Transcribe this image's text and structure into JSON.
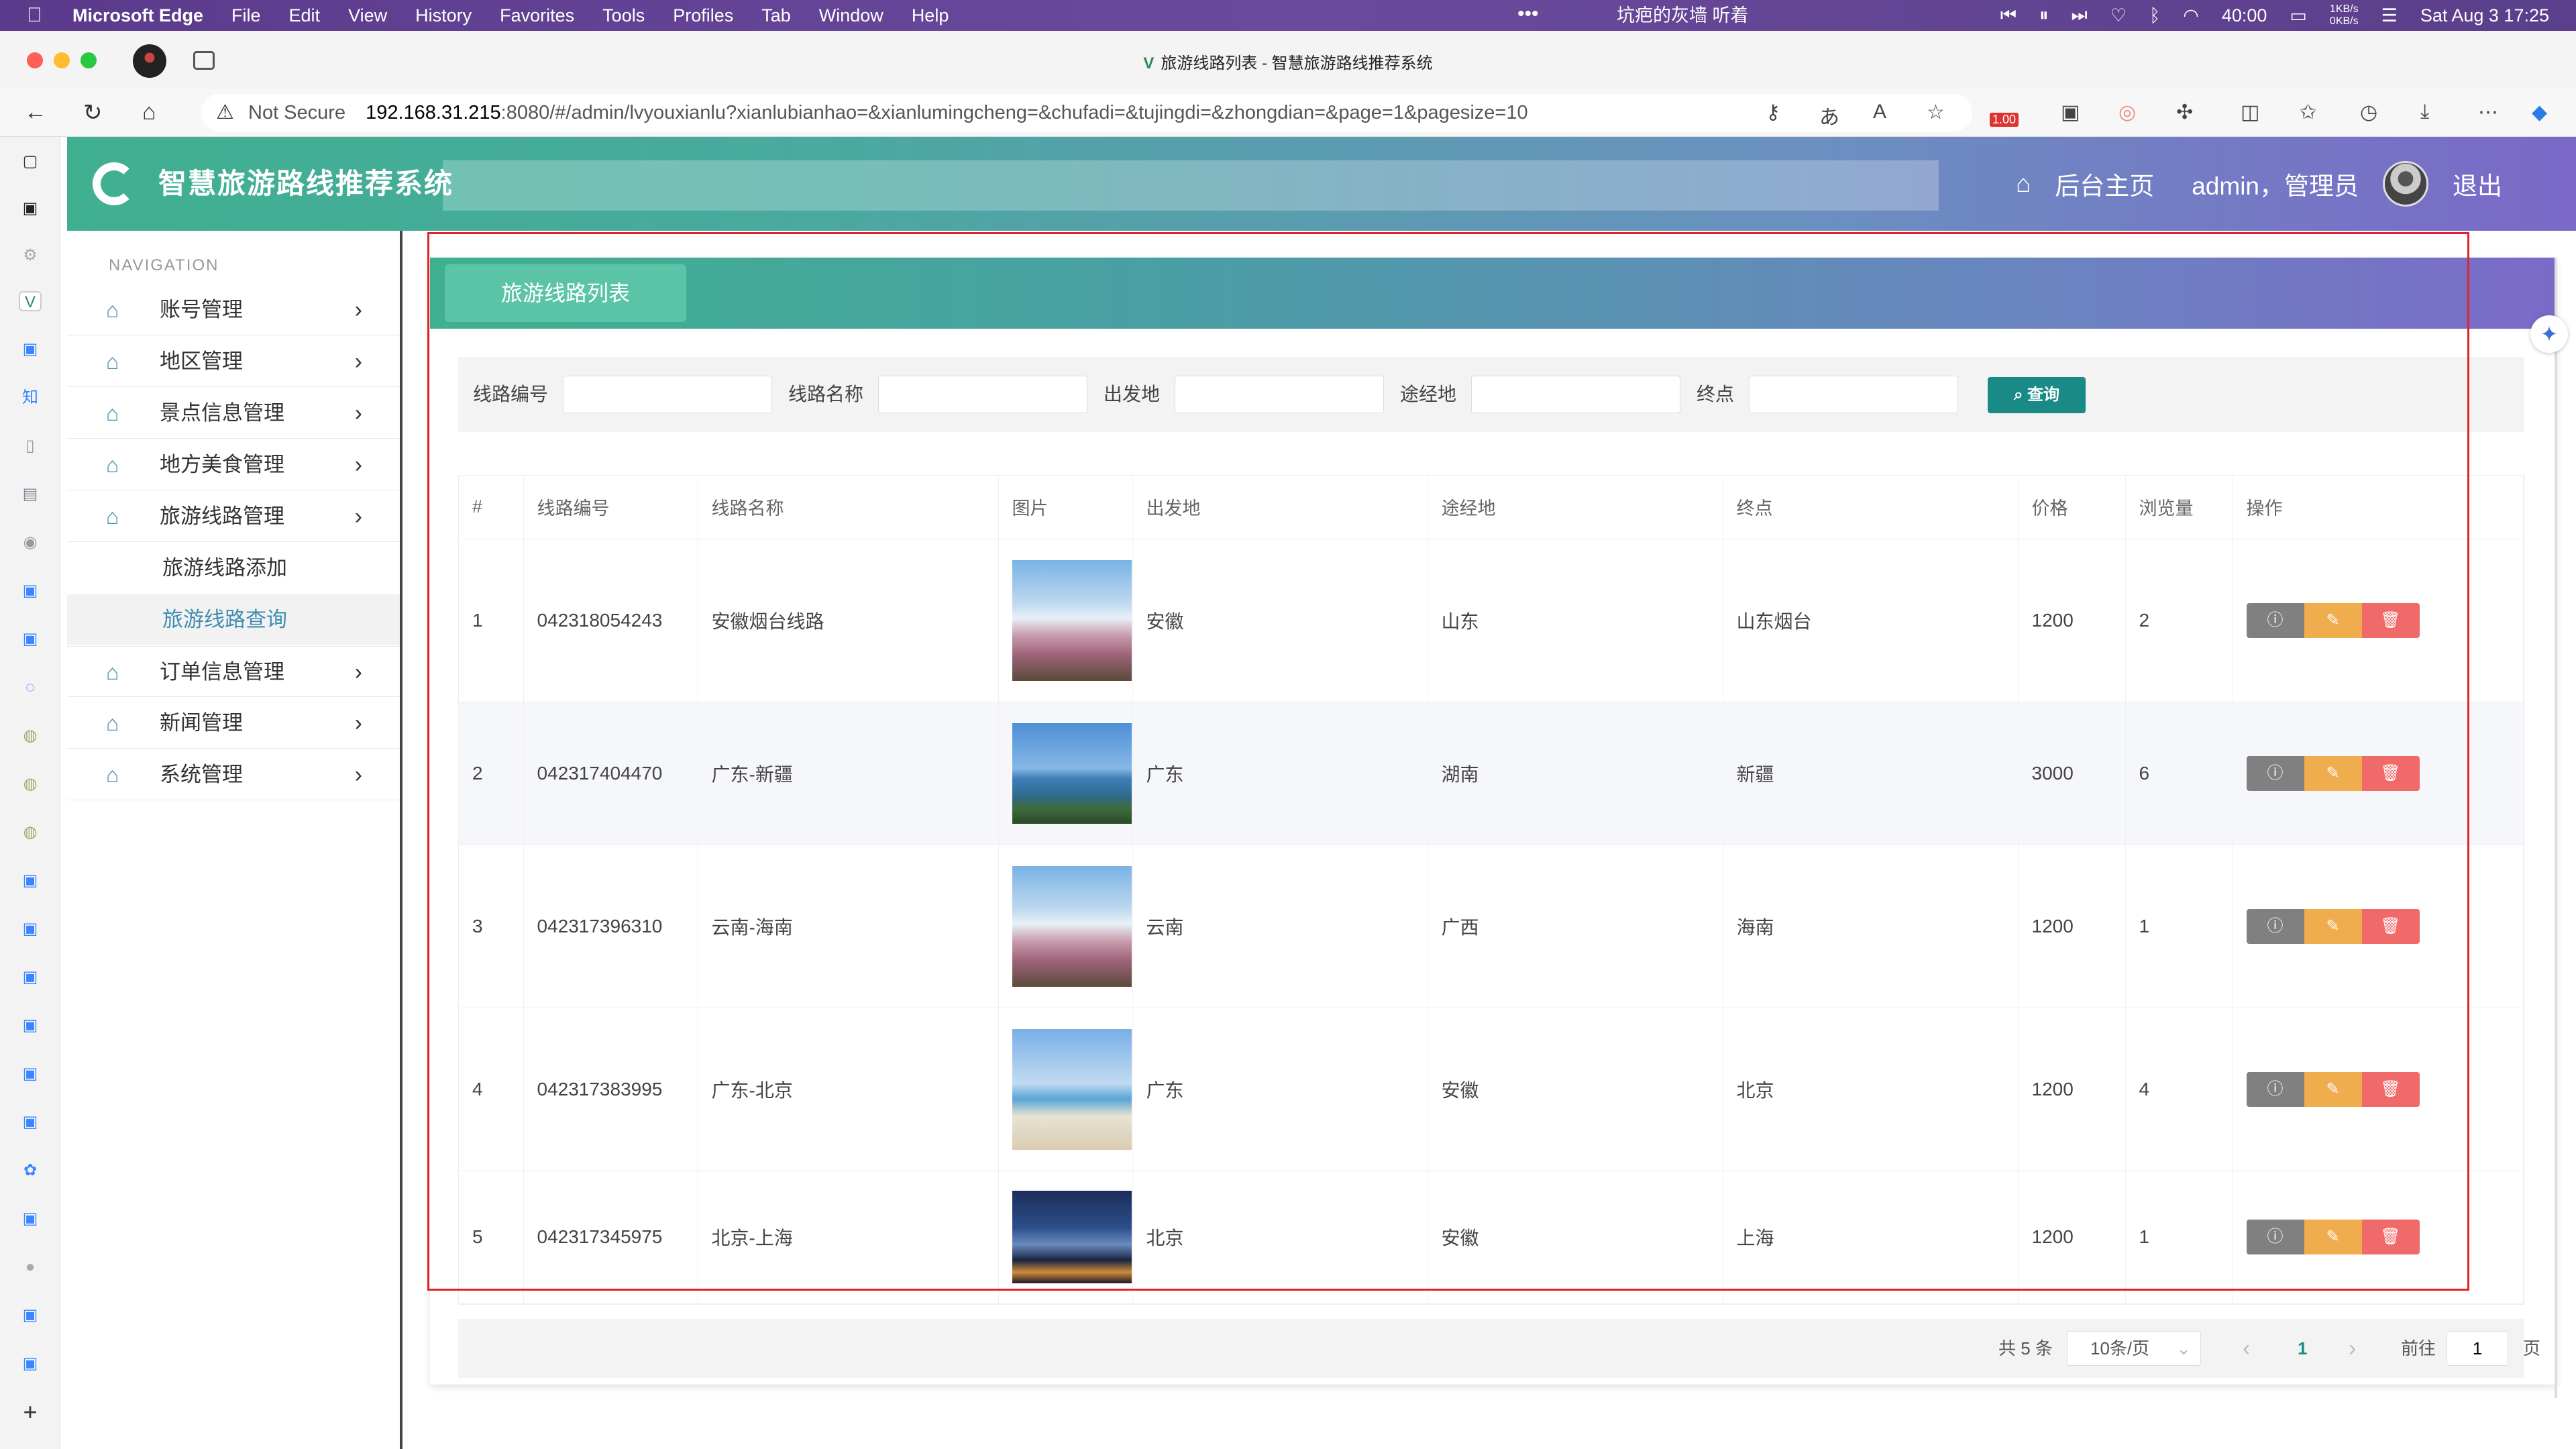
{
  "mac_menubar": {
    "app_name": "Microsoft Edge",
    "menus": [
      "File",
      "Edit",
      "View",
      "History",
      "Favorites",
      "Tools",
      "Profiles",
      "Tab",
      "Window",
      "Help"
    ],
    "now_playing": "坑疤的灰墙 听着",
    "battery_time": "40:00",
    "net_speed_up": "1KB/s",
    "net_speed_down": "0KB/s",
    "datetime": "Sat Aug 3  17:25"
  },
  "browser": {
    "tab_title": "旅游线路列表 - 智慧旅游路线推荐系统",
    "security_label": "Not Secure",
    "url_host": "192.168.31.215",
    "url_rest": ":8080/#/admin/lvyouxianlu?xianlubianhao=&xianlumingcheng=&chufadi=&tujingdi=&zhongdian=&page=1&pagesize=10",
    "ext_badge": "1.00"
  },
  "header": {
    "system_title": "智慧旅游路线推荐系统",
    "home_label": "后台主页",
    "user_label": "admin，管理员",
    "logout_label": "退出"
  },
  "sidebar": {
    "heading": "NAVIGATION",
    "items": [
      {
        "label": "账号管理"
      },
      {
        "label": "地区管理"
      },
      {
        "label": "景点信息管理"
      },
      {
        "label": "地方美食管理"
      },
      {
        "label": "旅游线路管理"
      },
      {
        "label": "订单信息管理"
      },
      {
        "label": "新闻管理"
      },
      {
        "label": "系统管理"
      }
    ],
    "subitems": [
      {
        "label": "旅游线路添加"
      },
      {
        "label": "旅游线路查询"
      }
    ]
  },
  "panel": {
    "tab_label": "旅游线路列表"
  },
  "search": {
    "labels": [
      "线路编号",
      "线路名称",
      "出发地",
      "途经地",
      "终点"
    ],
    "values": [
      "",
      "",
      "",
      "",
      ""
    ],
    "button_label": "查询"
  },
  "table": {
    "headers": [
      "#",
      "线路编号",
      "线路名称",
      "图片",
      "出发地",
      "途经地",
      "终点",
      "价格",
      "浏览量",
      "操作"
    ],
    "rows": [
      {
        "idx": "1",
        "code": "042318054243",
        "name": "安徽烟台线路",
        "image": "fuji",
        "from": "安徽",
        "via": "山东",
        "to": "山东烟台",
        "price": "1200",
        "views": "2"
      },
      {
        "idx": "2",
        "code": "042317404470",
        "name": "广东-新疆",
        "image": "lighthouse",
        "from": "广东",
        "via": "湖南",
        "to": "新疆",
        "price": "3000",
        "views": "6"
      },
      {
        "idx": "3",
        "code": "042317396310",
        "name": "云南-海南",
        "image": "fuji",
        "from": "云南",
        "via": "广西",
        "to": "海南",
        "price": "1200",
        "views": "1"
      },
      {
        "idx": "4",
        "code": "042317383995",
        "name": "广东-北京",
        "image": "beach",
        "from": "广东",
        "via": "安徽",
        "to": "北京",
        "price": "1200",
        "views": "4"
      },
      {
        "idx": "5",
        "code": "042317345975",
        "name": "北京-上海",
        "image": "night-coast",
        "from": "北京",
        "via": "安徽",
        "to": "上海",
        "price": "1200",
        "views": "1"
      }
    ]
  },
  "pagination": {
    "total_text": "共 5 条",
    "page_size": "10条/页",
    "current_page": "1",
    "goto_label": "前往",
    "goto_value": "1",
    "page_suffix": "页"
  },
  "colors": {
    "header_gradient_start": "#3fb08f",
    "header_gradient_end": "#7b68c8",
    "query_button": "#1a8a86",
    "view_button": "#808080",
    "edit_button": "#f0ad4e",
    "delete_button": "#f06a6a",
    "highlight_frame": "#e0232a"
  }
}
